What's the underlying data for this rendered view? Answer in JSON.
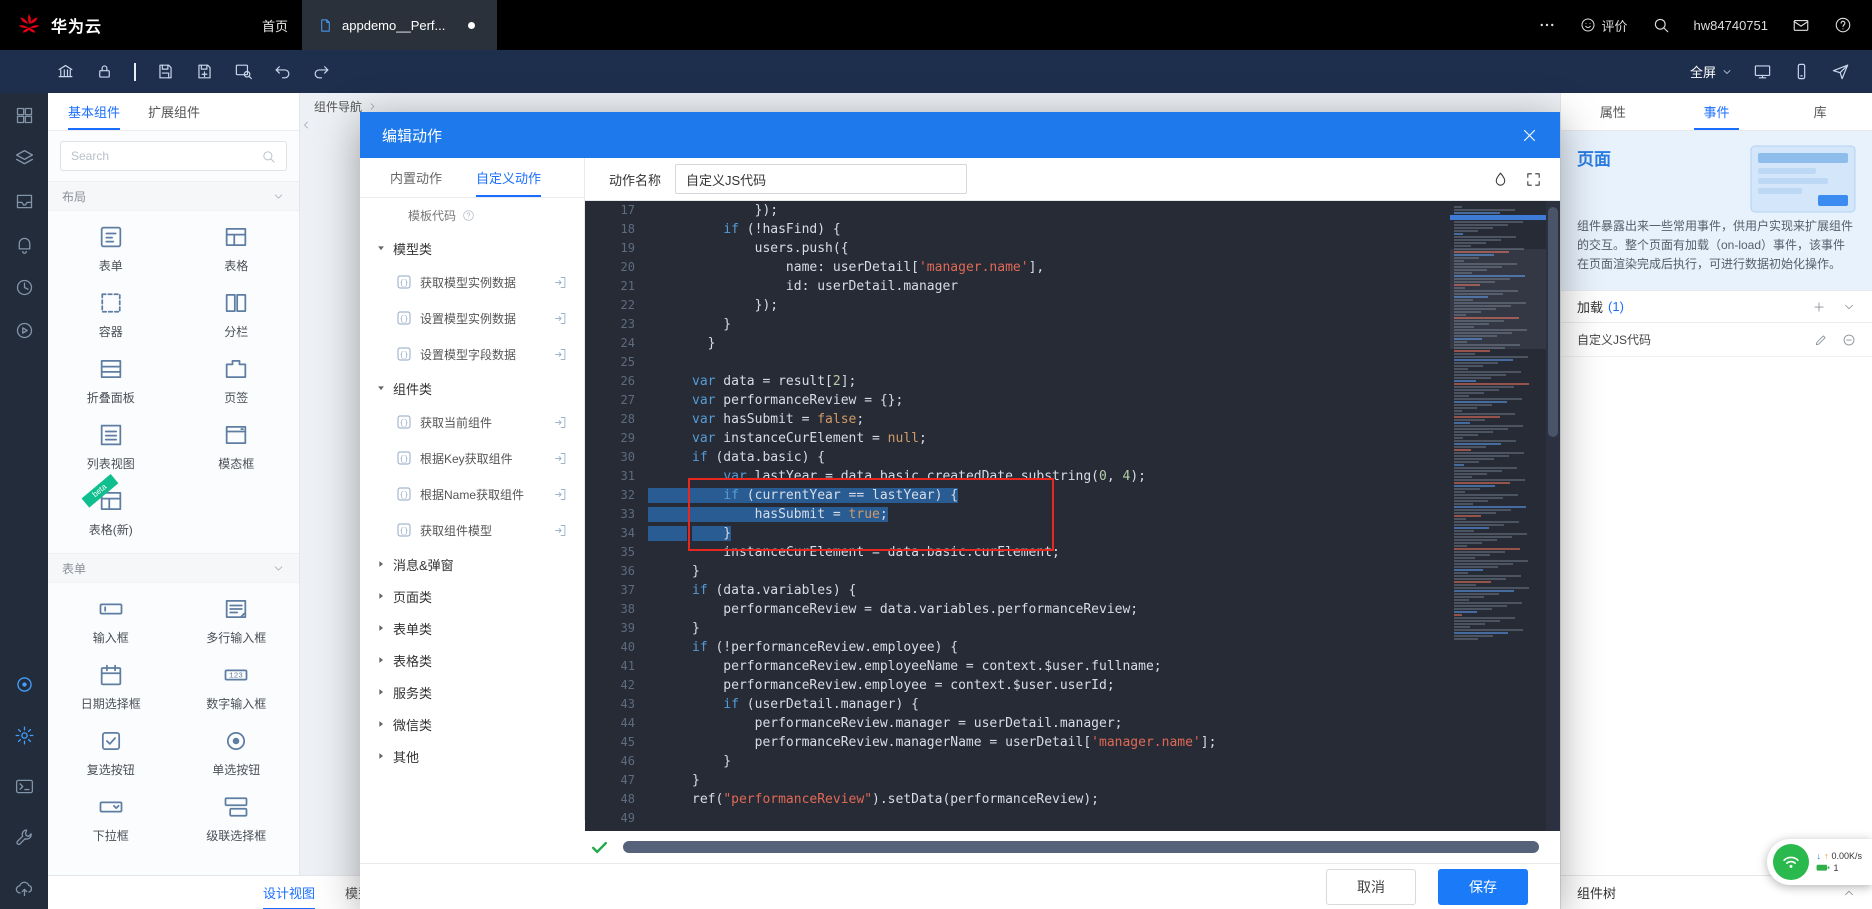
{
  "colors": {
    "accent": "#1A7AF8",
    "modal_header": "#1E79EC",
    "editor_background": "#262B36",
    "selection": "#2A5C94",
    "annotation_red": "#E8281E",
    "keyword": "#569CD6",
    "string": "#E06955",
    "literal": "#D19A66",
    "number": "#B5CEA8",
    "beta_badge": "#10BF8E"
  },
  "topbar": {
    "brand": "华为云",
    "home": "首页",
    "tab_label": "appdemo__Perf...",
    "feedback": "评价",
    "username": "hw84740751"
  },
  "toolbar": {
    "fullscreen_label": "全屏"
  },
  "rail": {
    "top": [
      {
        "icon": "apps"
      },
      {
        "icon": "layers"
      },
      {
        "icon": "tray"
      },
      {
        "icon": "bell"
      },
      {
        "icon": "history"
      },
      {
        "icon": "debug"
      }
    ],
    "bottom": [
      {
        "icon": "scan",
        "accent": true
      },
      {
        "icon": "gear",
        "accent": true
      },
      {
        "icon": "terminal"
      },
      {
        "icon": "wrench"
      },
      {
        "icon": "publish"
      }
    ]
  },
  "components_panel": {
    "tabs": [
      {
        "label": "基本组件"
      },
      {
        "label": "扩展组件"
      }
    ],
    "search_placeholder": "Search",
    "sections": [
      {
        "title": "布局",
        "items": [
          {
            "label": "表单",
            "icon": "form"
          },
          {
            "label": "表格",
            "icon": "table"
          },
          {
            "label": "容器",
            "icon": "container"
          },
          {
            "label": "分栏",
            "icon": "columns"
          },
          {
            "label": "折叠面板",
            "icon": "collapse"
          },
          {
            "label": "页签",
            "icon": "tabs"
          },
          {
            "label": "列表视图",
            "icon": "list"
          },
          {
            "label": "模态框",
            "icon": "modalbox"
          },
          {
            "label": "表格(新)",
            "icon": "table",
            "badge": "beta"
          }
        ]
      },
      {
        "title": "表单",
        "items": [
          {
            "label": "输入框",
            "icon": "inputbox"
          },
          {
            "label": "多行输入框",
            "icon": "textarea"
          },
          {
            "label": "日期选择框",
            "icon": "date"
          },
          {
            "label": "数字输入框",
            "icon": "number"
          },
          {
            "label": "复选按钮",
            "icon": "checkbox"
          },
          {
            "label": "单选按钮",
            "icon": "radio"
          },
          {
            "label": "下拉框",
            "icon": "select"
          },
          {
            "label": "级联选择框",
            "icon": "cascade"
          }
        ]
      }
    ]
  },
  "canvas": {
    "nav_header": "组件导航",
    "bottom_tabs": [
      {
        "label": "设计视图",
        "active": true
      },
      {
        "label": "模型视图"
      }
    ]
  },
  "modal": {
    "title": "编辑动作",
    "tabs": [
      {
        "label": "内置动作"
      },
      {
        "label": "自定义动作",
        "active": true
      }
    ],
    "template_link": "模板代码",
    "tree": [
      {
        "label": "模型类",
        "expanded": true,
        "items": [
          "获取模型实例数据",
          "设置模型实例数据",
          "设置模型字段数据"
        ]
      },
      {
        "label": "组件类",
        "expanded": true,
        "items": [
          "获取当前组件",
          "根据Key获取组件",
          "根据Name获取组件",
          "获取组件模型"
        ]
      },
      {
        "label": "消息&弹窗"
      },
      {
        "label": "页面类"
      },
      {
        "label": "表单类"
      },
      {
        "label": "表格类"
      },
      {
        "label": "服务类"
      },
      {
        "label": "微信类"
      },
      {
        "label": "其他"
      }
    ],
    "action_name_label": "动作名称",
    "action_name_value": "自定义JS代码",
    "footer": {
      "cancel": "取消",
      "save": "保存"
    }
  },
  "editor": {
    "first_line": 17,
    "selected_lines": [
      32,
      33,
      34
    ],
    "lines": [
      {
        "n": 17,
        "t": [
          [
            "p",
            "        });"
          ]
        ]
      },
      {
        "n": 18,
        "t": [
          [
            "p",
            "    "
          ],
          [
            "k",
            "if"
          ],
          [
            "p",
            " (!hasFind) {"
          ]
        ]
      },
      {
        "n": 19,
        "t": [
          [
            "p",
            "        users.push({"
          ]
        ]
      },
      {
        "n": 20,
        "t": [
          [
            "p",
            "            name: userDetail["
          ],
          [
            "s",
            "'manager.name'"
          ],
          [
            "p",
            "],"
          ]
        ]
      },
      {
        "n": 21,
        "t": [
          [
            "p",
            "            id: userDetail.manager"
          ]
        ]
      },
      {
        "n": 22,
        "t": [
          [
            "p",
            "        });"
          ]
        ]
      },
      {
        "n": 23,
        "t": [
          [
            "p",
            "    }"
          ]
        ]
      },
      {
        "n": 24,
        "t": [
          [
            "p",
            "  }"
          ]
        ]
      },
      {
        "n": 25,
        "t": []
      },
      {
        "n": 26,
        "t": [
          [
            "k",
            "var"
          ],
          [
            "p",
            " data = result["
          ],
          [
            "n2",
            "2"
          ],
          [
            "p",
            "];"
          ]
        ]
      },
      {
        "n": 27,
        "t": [
          [
            "k",
            "var"
          ],
          [
            "p",
            " performanceReview = {};"
          ]
        ]
      },
      {
        "n": 28,
        "t": [
          [
            "k",
            "var"
          ],
          [
            "p",
            " hasSubmit = "
          ],
          [
            "l",
            "false"
          ],
          [
            "p",
            ";"
          ]
        ]
      },
      {
        "n": 29,
        "t": [
          [
            "k",
            "var"
          ],
          [
            "p",
            " instanceCurElement = "
          ],
          [
            "l",
            "null"
          ],
          [
            "p",
            ";"
          ]
        ]
      },
      {
        "n": 30,
        "t": [
          [
            "k",
            "if"
          ],
          [
            "p",
            " (data.basic) {"
          ]
        ]
      },
      {
        "n": 31,
        "t": [
          [
            "p",
            "    "
          ],
          [
            "k",
            "var"
          ],
          [
            "p",
            " lastYear = data.basic.createdDate.substring("
          ],
          [
            "n2",
            "0"
          ],
          [
            "p",
            ", "
          ],
          [
            "n2",
            "4"
          ],
          [
            "p",
            ");"
          ]
        ]
      },
      {
        "n": 32,
        "t": [
          [
            "p",
            "    "
          ],
          [
            "k",
            "if"
          ],
          [
            "p",
            " (currentYear == lastYear) {"
          ]
        ]
      },
      {
        "n": 33,
        "t": [
          [
            "p",
            "        hasSubmit = "
          ],
          [
            "l",
            "true"
          ],
          [
            "p",
            ";"
          ]
        ]
      },
      {
        "n": 34,
        "t": [
          [
            "p",
            "    }"
          ]
        ]
      },
      {
        "n": 35,
        "t": [
          [
            "p",
            "    instanceCurElement = data.basic.curElement;"
          ]
        ]
      },
      {
        "n": 36,
        "t": [
          [
            "p",
            "}"
          ]
        ]
      },
      {
        "n": 37,
        "t": [
          [
            "k",
            "if"
          ],
          [
            "p",
            " (data.variables) {"
          ]
        ]
      },
      {
        "n": 38,
        "t": [
          [
            "p",
            "    performanceReview = data.variables.performanceReview;"
          ]
        ]
      },
      {
        "n": 39,
        "t": [
          [
            "p",
            "}"
          ]
        ]
      },
      {
        "n": 40,
        "t": [
          [
            "k",
            "if"
          ],
          [
            "p",
            " (!performanceReview.employee) {"
          ]
        ]
      },
      {
        "n": 41,
        "t": [
          [
            "p",
            "    performanceReview.employeeName = context.$user.fullname;"
          ]
        ]
      },
      {
        "n": 42,
        "t": [
          [
            "p",
            "    performanceReview.employee = context.$user.userId;"
          ]
        ]
      },
      {
        "n": 43,
        "t": [
          [
            "p",
            "    "
          ],
          [
            "k",
            "if"
          ],
          [
            "p",
            " (userDetail.manager) {"
          ]
        ]
      },
      {
        "n": 44,
        "t": [
          [
            "p",
            "        performanceReview.manager = userDetail.manager;"
          ]
        ]
      },
      {
        "n": 45,
        "t": [
          [
            "p",
            "        performanceReview.managerName = userDetail["
          ],
          [
            "s",
            "'manager.name'"
          ],
          [
            "p",
            "];"
          ]
        ]
      },
      {
        "n": 46,
        "t": [
          [
            "p",
            "    }"
          ]
        ]
      },
      {
        "n": 47,
        "t": [
          [
            "p",
            "}"
          ]
        ]
      },
      {
        "n": 48,
        "t": [
          [
            "p",
            "ref("
          ],
          [
            "s",
            "\"performanceReview\""
          ],
          [
            "p",
            ").setData(performanceReview);"
          ]
        ]
      },
      {
        "n": 49,
        "t": []
      }
    ]
  },
  "events_panel": {
    "tabs": [
      {
        "label": "属性"
      },
      {
        "label": "事件",
        "active": true
      },
      {
        "label": "库"
      }
    ],
    "title": "页面",
    "description": "组件暴露出来一些常用事件，供用户实现来扩展组件的交互。整个页面有加载（on-load）事件，该事件在页面渲染完成后执行，可进行数据初始化操作。",
    "load_label": "加载",
    "load_count": "(1)",
    "event_item": "自定义JS代码",
    "component_tree_label": "组件树"
  },
  "network_widget": {
    "speed": "0.00K/s",
    "count": "1"
  }
}
